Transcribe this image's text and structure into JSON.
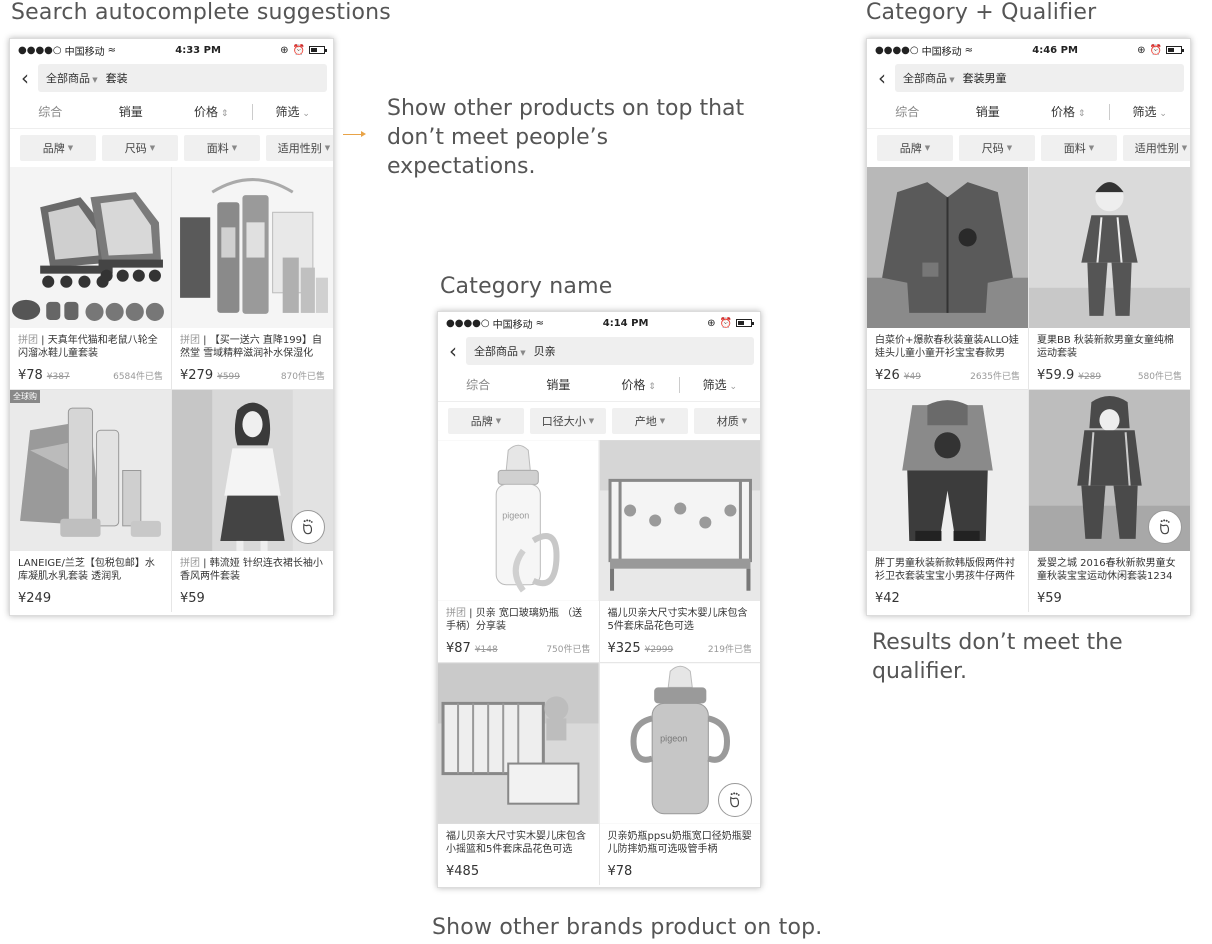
{
  "captions": {
    "left": "Search autocomplete suggestions",
    "center": "Category name",
    "right": "Category + Qualifier",
    "bottom": "Show other brands product on top.",
    "note_left": "Show other products on top that don’t meet people’s expectations.",
    "note_right": "Results don’t meet the qualifier."
  },
  "arrow_color": "#e8a347",
  "common": {
    "carrier": "中国移动",
    "scope": "全部商品",
    "sort": [
      "综合",
      "销量",
      "价格",
      "筛选"
    ],
    "sort_price_icon": "updown-icon",
    "sort_filter_icon": "chevron-down-icon"
  },
  "phones": [
    {
      "time": "4:33 PM",
      "query": "套装",
      "filters": [
        "品牌",
        "尺码",
        "面料",
        "适用性别"
      ],
      "products": [
        {
          "tag": "拼团",
          "title": "天真年代猫和老鼠八轮全闪溜冰鞋儿童套装",
          "price": "¥78",
          "old": "¥387",
          "sold": "6584件已售",
          "img": "roller-skates"
        },
        {
          "tag": "拼团",
          "title": "【买一送六 直降199】自然堂 雪域精粹滋润补水保湿化",
          "price": "¥279",
          "old": "¥599",
          "sold": "870件已售",
          "img": "cosmetics-set"
        },
        {
          "badge": "全球购",
          "title": "LANEIGE/兰芝【包税包邮】水库凝肌水乳套装 透润乳",
          "price": "¥249",
          "old": "",
          "sold": "",
          "img": "laneige-set"
        },
        {
          "tag": "拼团",
          "title": "韩流娅 针织连衣裙长袖小香风两件套装",
          "price": "¥59",
          "old": "",
          "sold": "",
          "img": "woman-dress",
          "foot": true
        }
      ]
    },
    {
      "time": "4:14 PM",
      "query": "贝亲",
      "filters": [
        "品牌",
        "口径大小",
        "产地",
        "材质"
      ],
      "products": [
        {
          "tag": "拼团",
          "title": "贝亲 宽口玻璃奶瓶 （送手柄）分享装",
          "price": "¥87",
          "old": "¥148",
          "sold": "750件已售",
          "img": "glass-bottle"
        },
        {
          "tag": "",
          "title": "福儿贝亲大尺寸实木婴儿床包含5件套床品花色可选",
          "price": "¥325",
          "old": "¥2999",
          "sold": "219件已售",
          "img": "crib"
        },
        {
          "tag": "",
          "title": "福儿贝亲大尺寸实木婴儿床包含小摇篮和5件套床品花色可选",
          "price": "¥485",
          "old": "",
          "sold": "",
          "img": "crib-cradle"
        },
        {
          "tag": "",
          "title": "贝亲奶瓶ppsu奶瓶宽口径奶瓶婴儿防摔奶瓶可选吸管手柄",
          "price": "¥78",
          "old": "",
          "sold": "",
          "img": "ppsu-bottle",
          "foot": true
        }
      ]
    },
    {
      "time": "4:46 PM",
      "query": "套装男童",
      "filters": [
        "品牌",
        "尺码",
        "面料",
        "适用性别"
      ],
      "products": [
        {
          "tag": "",
          "title": "白菜价+爆款春秋装童装ALLO娃娃头儿童小童开衫宝宝春款男",
          "price": "¥26",
          "old": "¥49",
          "sold": "2635件已售",
          "img": "red-cardigan"
        },
        {
          "tag": "",
          "title": "夏果BB 秋装新款男童女童纯棉运动套装",
          "price": "¥59.9",
          "old": "¥289",
          "sold": "580件已售",
          "img": "girl-tracksuit"
        },
        {
          "tag": "",
          "title": "胖丁男童秋装新款韩版假两件衬衫卫衣套装宝宝小男孩牛仔两件",
          "price": "¥42",
          "old": "",
          "sold": "",
          "img": "boy-jeans"
        },
        {
          "tag": "",
          "title": "爱婴之城 2016春秋新款男童女童秋装宝宝运动休闲套装1234",
          "price": "¥59",
          "old": "",
          "sold": "",
          "img": "boy-hoodie",
          "foot": true
        }
      ]
    }
  ]
}
